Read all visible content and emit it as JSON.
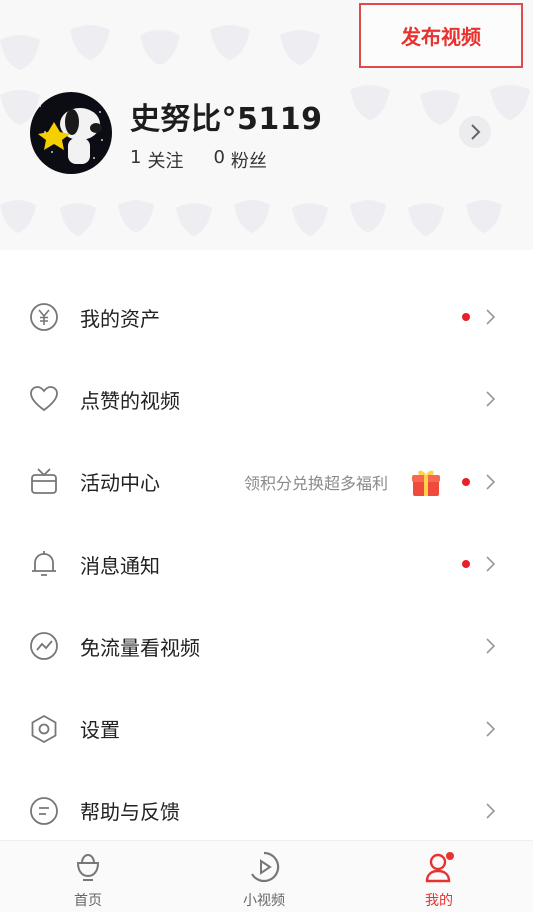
{
  "header": {
    "publish_label": "发布视频",
    "username": "史努比°5119",
    "stats": [
      {
        "count": "1",
        "label": "关注"
      },
      {
        "count": "0",
        "label": "粉丝"
      }
    ]
  },
  "menu": [
    {
      "label": "我的资产",
      "icon": "yuan-coin-icon",
      "dot": true
    },
    {
      "label": "点赞的视频",
      "icon": "heart-icon",
      "dot": false
    },
    {
      "label": "活动中心",
      "icon": "tv-icon",
      "hint": "领积分兑换超多福利",
      "gift": true,
      "dot": true
    },
    {
      "label": "消息通知",
      "icon": "bell-icon",
      "dot": true
    },
    {
      "label": "免流量看视频",
      "icon": "trend-icon",
      "dot": false
    },
    {
      "label": "设置",
      "icon": "hexagon-settings-icon",
      "dot": false
    },
    {
      "label": "帮助与反馈",
      "icon": "feedback-icon",
      "dot": false
    }
  ],
  "tabbar": {
    "tabs": [
      {
        "label": "首页",
        "icon": "home-icon"
      },
      {
        "label": "小视频",
        "icon": "play-icon"
      },
      {
        "label": "我的",
        "icon": "profile-icon",
        "active": true
      }
    ]
  },
  "colors": {
    "accent": "#e8322f",
    "dot": "#e8202a",
    "icon_gray": "#666666"
  }
}
